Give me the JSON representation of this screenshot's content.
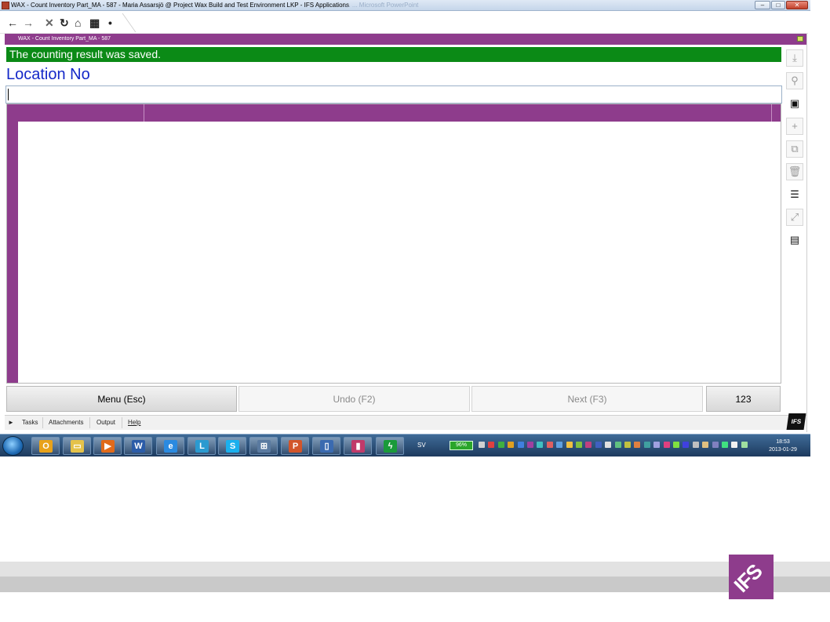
{
  "window": {
    "title": "WAX - Count Inventory Part_MA - 587 - Maria  Assarsjö @ Project Wax Build and Test Environment LKP - IFS Applications",
    "ghost_title": "...   ...   Microsoft PowerPoint",
    "minimize_glyph": "–",
    "maximize_glyph": "□",
    "close_glyph": "✕"
  },
  "nav": {
    "back_glyph": "←",
    "forward_glyph": "→",
    "stop_glyph": "✕",
    "refresh_glyph": "↻",
    "home_glyph": "⌂",
    "grid_glyph": "▦",
    "dot_glyph": "•"
  },
  "caption": {
    "title": "WAX - Count Inventory Part_MA - 587"
  },
  "banner": {
    "message": "The counting result was saved."
  },
  "location": {
    "label": "Location No",
    "value": ""
  },
  "buttons": {
    "menu": "Menu (Esc)",
    "undo": "Undo (F2)",
    "next": "Next (F3)",
    "numeric": "123"
  },
  "sidebar": {
    "download_glyph": "⤓",
    "search_glyph": "⚲",
    "save_glyph": "▣",
    "add_glyph": "+",
    "duplicate_glyph": "⧉",
    "delete_glyph": "🗑",
    "list_glyph": "☰",
    "expand_glyph": "⤢",
    "details_glyph": "▤"
  },
  "status_tabs": {
    "arrow": "►",
    "tasks": "Tasks",
    "attachments": "Attachments",
    "output": "Output",
    "help": "Help"
  },
  "brand": {
    "mini": "IFS",
    "logo": "IFS",
    "color": "#8e3c8c"
  },
  "taskbar": {
    "language": "SV",
    "battery": "96%",
    "time": "18:53",
    "date": "2013-01-29",
    "apps": [
      {
        "name": "outlook",
        "glyph": "O",
        "color": "#e8a21a"
      },
      {
        "name": "explorer",
        "glyph": "▭",
        "color": "#e4c24a"
      },
      {
        "name": "media",
        "glyph": "▶",
        "color": "#e06a1a"
      },
      {
        "name": "word",
        "glyph": "W",
        "color": "#2b5ca8"
      },
      {
        "name": "ie",
        "glyph": "e",
        "color": "#2a8ae0"
      },
      {
        "name": "lync",
        "glyph": "L",
        "color": "#2a9ad0"
      },
      {
        "name": "skype",
        "glyph": "S",
        "color": "#1ab0ee"
      },
      {
        "name": "remote",
        "glyph": "⊞",
        "color": "#5a7aa0"
      },
      {
        "name": "powerpoint",
        "glyph": "P",
        "color": "#d2552a"
      },
      {
        "name": "device",
        "glyph": "▯",
        "color": "#3a6ab0"
      },
      {
        "name": "chart-app",
        "glyph": "▮",
        "color": "#c03a6a"
      },
      {
        "name": "ifs-app",
        "glyph": "ϟ",
        "color": "#1a9a3a"
      }
    ]
  }
}
